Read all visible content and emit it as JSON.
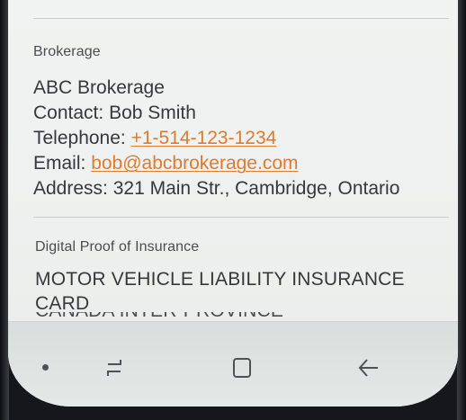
{
  "brokerage": {
    "section_label": "Brokerage",
    "name": "ABC Brokerage",
    "contact_label": "Contact:",
    "contact_name": "Bob Smith",
    "telephone_label": "Telephone:",
    "telephone": "+1-514-123-1234",
    "email_label": "Email:",
    "email": "bob@abcbrokerage.com",
    "address_label": "Address:",
    "address": "321 Main Str., Cambridge, Ontario"
  },
  "insurance": {
    "section_label": "Digital Proof of Insurance",
    "card_title_line1": "MOTOR VEHICLE LIABILITY INSURANCE",
    "card_title_line2": "CARD",
    "partial_line": "CANADA INTER-PROVINCE"
  },
  "navbar": {
    "buttons": [
      "dot-indicator",
      "recent-apps-icon",
      "home-icon",
      "back-icon"
    ],
    "icon_color": "#4c5256"
  },
  "colors": {
    "link": "#e07a2c",
    "text": "#36393b",
    "background": "#eef1ef"
  }
}
